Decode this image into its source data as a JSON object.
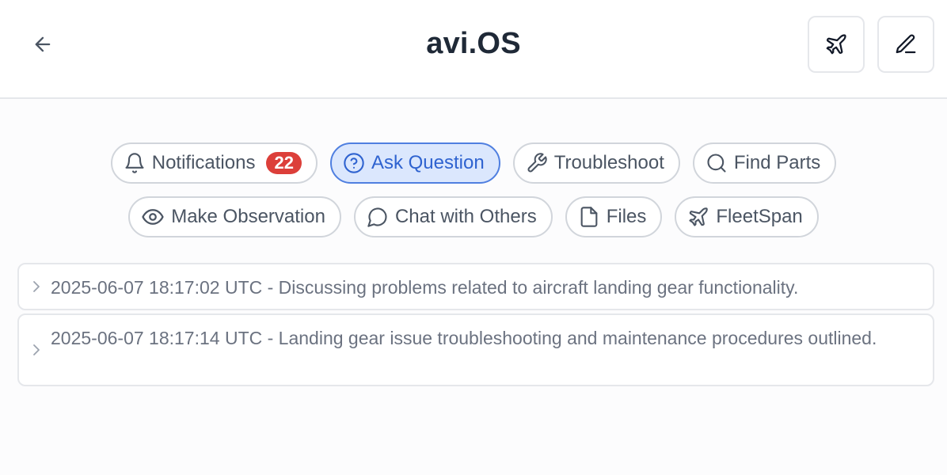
{
  "header": {
    "title": "avi.OS",
    "icons": {
      "back": "arrow-left-icon",
      "plane": "plane-icon",
      "edit": "pencil-icon"
    }
  },
  "actions": [
    {
      "label": "Notifications",
      "icon": "bell-icon",
      "badge": "22",
      "active": false
    },
    {
      "label": "Ask Question",
      "icon": "question-circle-icon",
      "active": true
    },
    {
      "label": "Troubleshoot",
      "icon": "wrench-icon",
      "active": false
    },
    {
      "label": "Find Parts",
      "icon": "search-icon",
      "active": false
    },
    {
      "label": "Make Observation",
      "icon": "eye-icon",
      "active": false
    },
    {
      "label": "Chat with Others",
      "icon": "chat-bubble-icon",
      "active": false
    },
    {
      "label": "Files",
      "icon": "file-icon",
      "active": false
    },
    {
      "label": "FleetSpan",
      "icon": "plane-icon",
      "active": false
    }
  ],
  "sessions": [
    {
      "text": "2025-06-07 18:17:02 UTC - Discussing problems related to aircraft landing gear functionality."
    },
    {
      "text": "2025-06-07 18:17:14 UTC - Landing gear issue troubleshooting and maintenance procedures outlined."
    }
  ],
  "colors": {
    "accent": "#2f63d0",
    "accent_bg": "#dbe7fd",
    "badge": "#dc3f3a"
  }
}
